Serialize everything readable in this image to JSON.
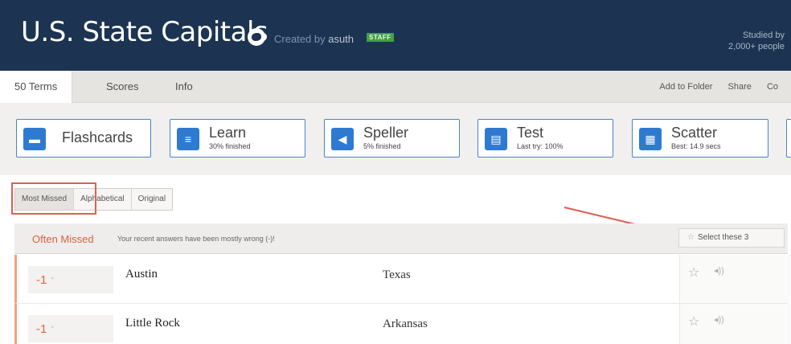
{
  "header": {
    "title": "U.S. State Capitals",
    "created_by_prefix": "Created by",
    "creator": "asuth",
    "badge": "STAFF",
    "studied_line1": "Studied by",
    "studied_line2": "2,000+ people"
  },
  "tabs": [
    {
      "label": "50 Terms"
    },
    {
      "label": "Scores"
    },
    {
      "label": "Info"
    }
  ],
  "tab_actions": [
    "Add to Folder",
    "Share",
    "Co"
  ],
  "modes": [
    {
      "name": "Flashcards",
      "sub": "",
      "icon": "flashcards-icon"
    },
    {
      "name": "Learn",
      "sub": "30% finished",
      "icon": "learn-icon"
    },
    {
      "name": "Speller",
      "sub": "5% finished",
      "icon": "speaker-icon"
    },
    {
      "name": "Test",
      "sub": "Last try: 100%",
      "icon": "document-icon"
    },
    {
      "name": "Scatter",
      "sub": "Best: 14.9 secs",
      "icon": "grid-icon"
    }
  ],
  "filters": [
    "Most Missed",
    "Alphabetical",
    "Original"
  ],
  "missed": {
    "title": "Often Missed",
    "subtitle": "Your recent answers have been mostly wrong (-)!",
    "select_label": "Select these 3"
  },
  "terms": [
    {
      "score": "-1",
      "term": "Austin",
      "definition": "Texas"
    },
    {
      "score": "-1",
      "term": "Little Rock",
      "definition": "Arkansas"
    }
  ],
  "colors": {
    "header_bg": "#1c3451",
    "accent_blue": "#2f7ad1",
    "missed_red": "#d95f3f",
    "annotation_red": "#df5f52"
  }
}
